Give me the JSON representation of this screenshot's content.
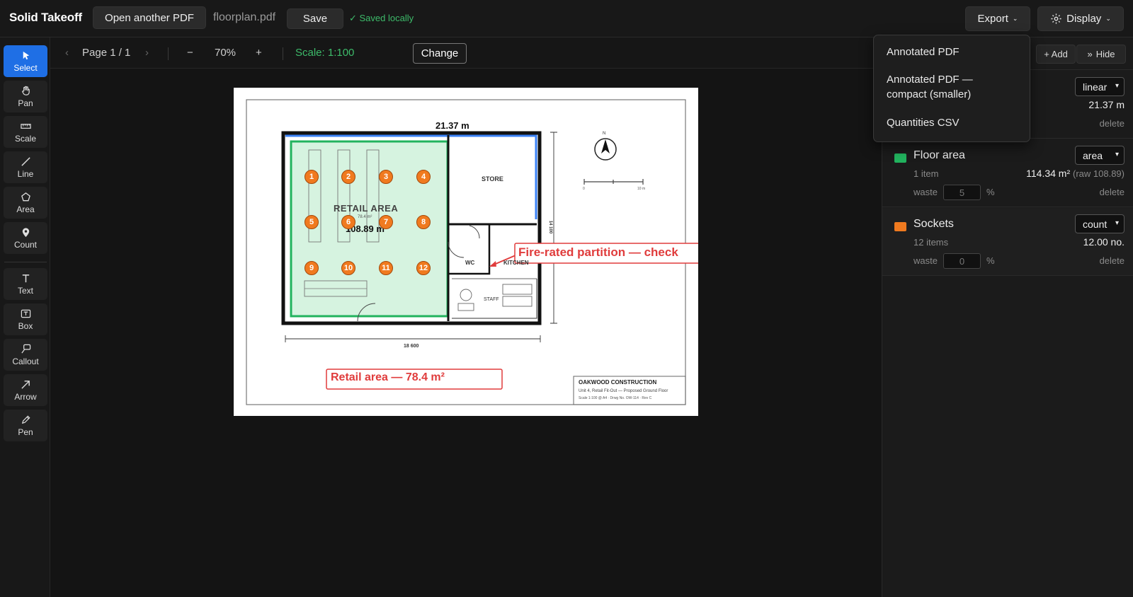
{
  "app": {
    "title": "Solid Takeoff"
  },
  "topbar": {
    "open_label": "Open another PDF",
    "filename": "floorplan.pdf",
    "save_label": "Save",
    "saved_status": "✓ Saved locally",
    "export_label": "Export",
    "display_label": "Display"
  },
  "tools": [
    {
      "label": "Select",
      "icon": "cursor-icon"
    },
    {
      "label": "Pan",
      "icon": "hand-icon"
    },
    {
      "label": "Scale",
      "icon": "ruler-icon"
    },
    {
      "label": "Line",
      "icon": "line-icon"
    },
    {
      "label": "Area",
      "icon": "pentagon-icon"
    },
    {
      "label": "Count",
      "icon": "pin-icon"
    },
    {
      "label": "Text",
      "icon": "text-icon"
    },
    {
      "label": "Box",
      "icon": "textbox-icon"
    },
    {
      "label": "Callout",
      "icon": "callout-icon"
    },
    {
      "label": "Arrow",
      "icon": "arrow-icon"
    },
    {
      "label": "Pen",
      "icon": "pen-icon"
    }
  ],
  "subbar": {
    "prev": "‹",
    "page": "Page 1 / 1",
    "next": "›",
    "zoom_out": "−",
    "zoom": "70%",
    "zoom_in": "+",
    "scale": "Scale: 1:100",
    "change_label": "Change"
  },
  "drawing": {
    "top_dimension": "21.37 m",
    "store": "STORE",
    "retail_area": "RETAIL AREA",
    "retail_sub": "78.4 m²",
    "area_measure": "108.89 m²",
    "wc": "WC",
    "kitchen": "KITCHEN",
    "staff": "STAFF",
    "right_dimension": "14 100",
    "bottom_dimension": "18 600",
    "north": "N",
    "scalebar_start": "0",
    "scalebar_end": "10 m",
    "callout": "Fire-rated partition — check",
    "retail_label": "Retail area — 78.4 m²",
    "titleblock_company": "OAKWOOD CONSTRUCTION",
    "titleblock_project": "Unit 4, Retail Fit-Out — Proposed Ground Floor",
    "titleblock_info": "Scale 1:100 @ A4 · Drwg No. OW-114 · Rev C",
    "count_markers": [
      "1",
      "2",
      "3",
      "4",
      "5",
      "6",
      "7",
      "8",
      "9",
      "10",
      "11",
      "12"
    ]
  },
  "panel": {
    "add_label": "+ Add",
    "hide_label": "Hide",
    "rows": [
      {
        "name": "",
        "type": "linear",
        "value": "21.37 m",
        "delete": "delete",
        "color": "#3b82f6"
      },
      {
        "name": "Floor area",
        "type": "area",
        "items": "1 item",
        "value": "114.34 m²",
        "raw": "(raw 108.89)",
        "waste_label": "waste",
        "waste": "5",
        "unit": "%",
        "delete": "delete",
        "color": "#22b35e"
      },
      {
        "name": "Sockets",
        "type": "count",
        "items": "12 items",
        "value": "12.00 no.",
        "waste_label": "waste",
        "waste": "0",
        "unit": "%",
        "delete": "delete",
        "color": "#f07a1f"
      }
    ]
  },
  "export_menu": {
    "items": [
      "Annotated PDF",
      "Annotated PDF —",
      "compact (smaller)",
      "Quantities CSV"
    ]
  },
  "colors": {
    "accent": "#1f6fe5",
    "callout_red": "#e03c3c",
    "count_orange": "#f07a1f",
    "area_green": "#22b35e",
    "saved_green": "#3dbb6a"
  }
}
